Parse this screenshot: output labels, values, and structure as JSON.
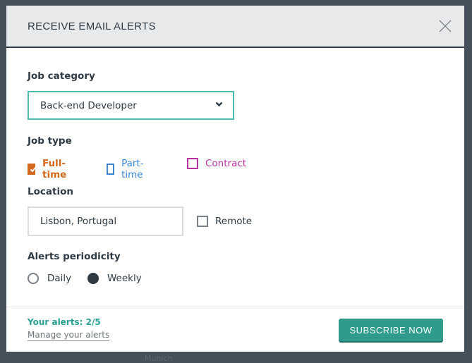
{
  "modal": {
    "title": "RECEIVE EMAIL ALERTS",
    "close_icon": "close-icon"
  },
  "job_category": {
    "label": "Job category",
    "selected": "Back-end Developer"
  },
  "job_type": {
    "label": "Job type",
    "options": [
      {
        "label": "Full-time",
        "checked": true,
        "color": "#d2691e"
      },
      {
        "label": "Part-time",
        "checked": false,
        "color": "#3a86d4"
      },
      {
        "label": "Contract",
        "checked": false,
        "color": "#b8329f"
      }
    ]
  },
  "location": {
    "label": "Location",
    "value": "Lisbon, Portugal",
    "remote_label": "Remote",
    "remote_checked": false
  },
  "periodicity": {
    "label": "Alerts periodicity",
    "options": [
      {
        "label": "Daily",
        "selected": false
      },
      {
        "label": "Weekly",
        "selected": true
      }
    ]
  },
  "footer": {
    "alerts_count": "Your alerts: 2/5",
    "manage_link": "Manage your alerts",
    "subscribe_label": "SUBSCRIBE NOW"
  },
  "background": {
    "hint_text": "Munich"
  },
  "colors": {
    "accent": "#2e9b8d",
    "select_border": "#4bbcb0",
    "header_bg": "#e8e9eb",
    "overlay": "#46505a"
  }
}
